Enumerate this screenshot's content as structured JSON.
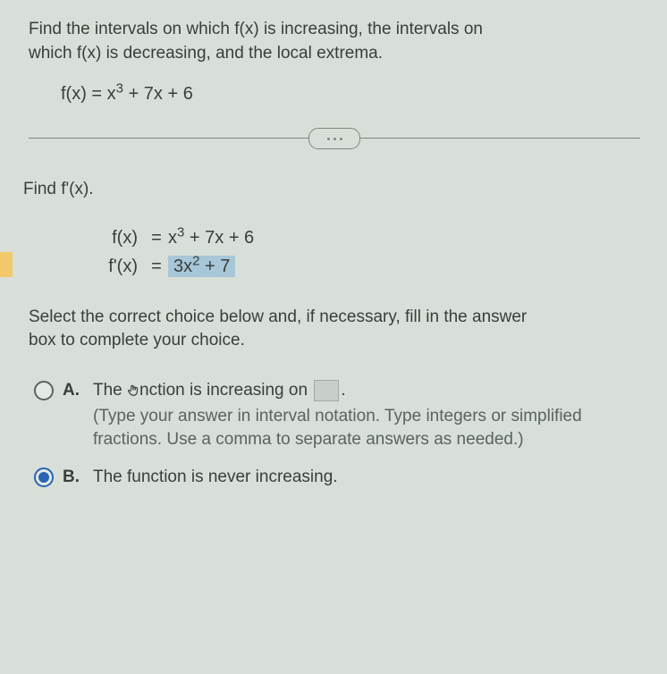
{
  "prompt_line1": "Find the intervals on which f(x) is increasing, the intervals on",
  "prompt_line2": "which f(x) is decreasing, and the local extrema.",
  "formula": {
    "lhs": "f(x) = x",
    "exp1": "3",
    "rhs": " + 7x + 6"
  },
  "step_heading": "Find f'(x).",
  "work": {
    "row1": {
      "left": "f(x)",
      "eq": "=",
      "rhs_a": "x",
      "rhs_exp": "3",
      "rhs_b": " + 7x + 6"
    },
    "row2": {
      "left": "f'(x)",
      "eq": "=",
      "ans_a": "3x",
      "ans_exp": "2",
      "ans_b": " + 7"
    }
  },
  "instruction_line1": "Select the correct choice below and, if necessary, fill in the answer",
  "instruction_line2": "box to complete your choice.",
  "choices": {
    "a": {
      "letter": "A.",
      "text_before": "The ",
      "text_after": "nction is increasing on ",
      "period": ".",
      "hint": "(Type your answer in interval notation. Type integers or simplified fractions. Use a comma to separate answers as needed.)"
    },
    "b": {
      "letter": "B.",
      "text": "The function is never increasing."
    }
  }
}
